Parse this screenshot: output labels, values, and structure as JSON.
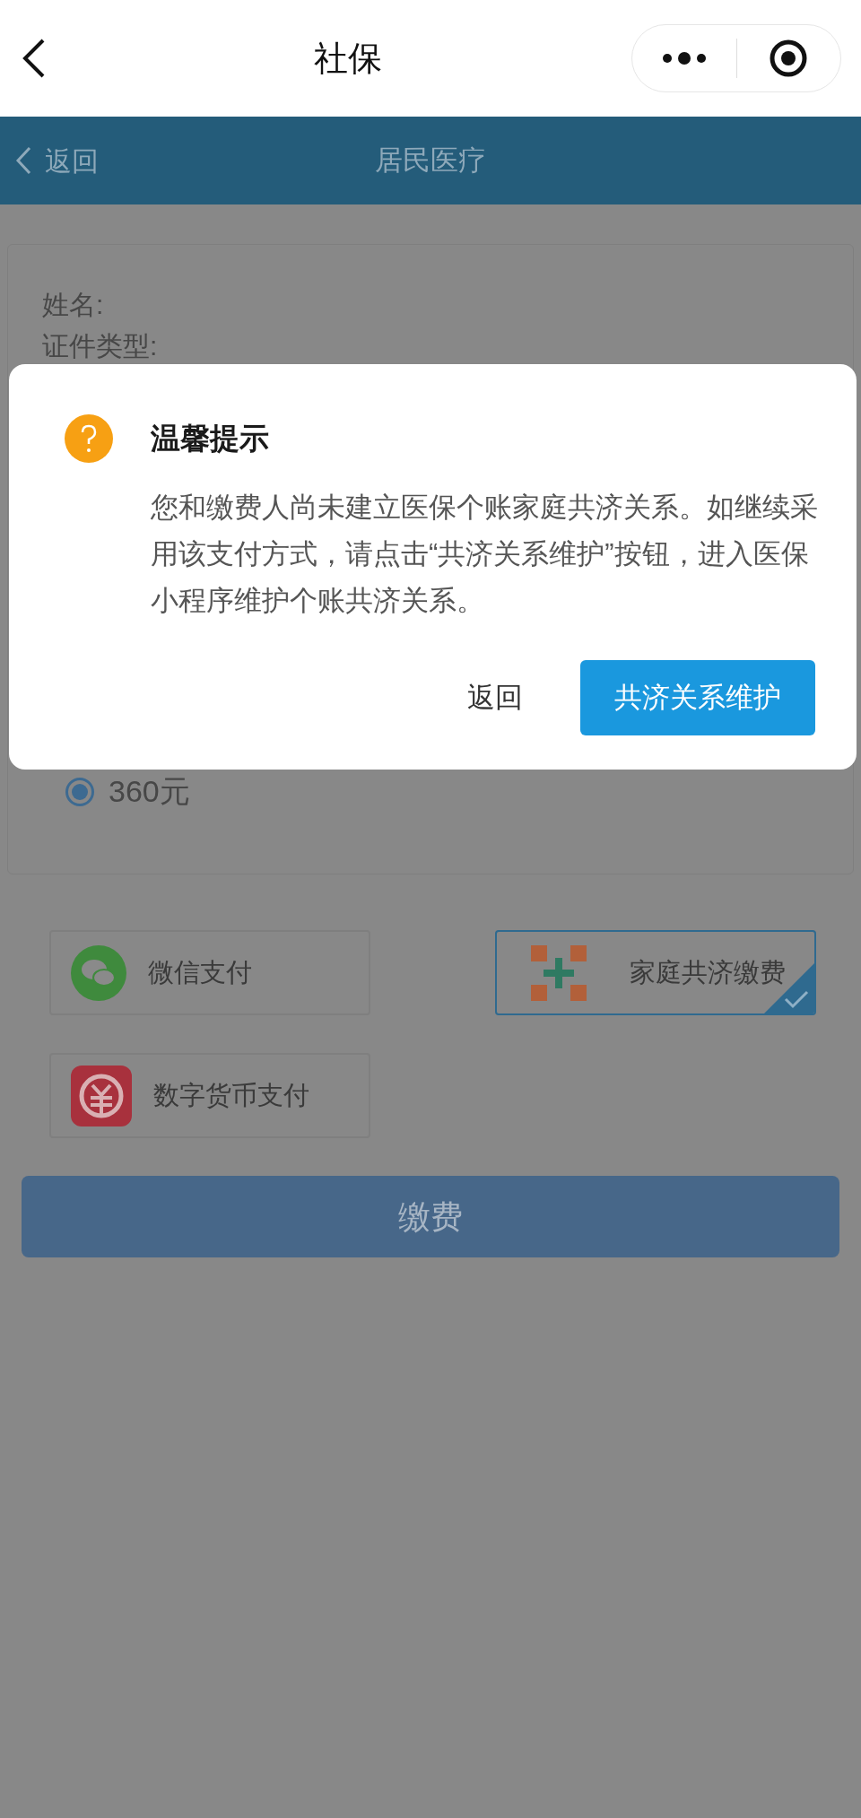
{
  "nav_bar": {
    "title": "社保"
  },
  "header": {
    "back": "返回",
    "title": "居民医疗"
  },
  "form": {
    "fields": [
      {
        "label": "姓名:"
      },
      {
        "label": "证件类型:"
      }
    ],
    "amount_options": [
      {
        "label": "360元",
        "selected": true
      }
    ]
  },
  "payment_methods": [
    {
      "kind": "wechat",
      "label": "微信支付",
      "selected": false
    },
    {
      "kind": "family",
      "label": "家庭共济缴费",
      "selected": true
    },
    {
      "kind": "digital",
      "label": "数字货币支付",
      "selected": false
    }
  ],
  "pay_button": "缴费",
  "dialog": {
    "title": "温馨提示",
    "message": "您和缴费人尚未建立医保个账家庭共济关系。如继续采用该支付方式，请点击“共济关系维护”按钮，进入医保小程序维护个账共济关系。",
    "buttons": [
      {
        "kind": "secondary",
        "label": "返回"
      },
      {
        "kind": "primary",
        "label": "共济关系维护"
      }
    ]
  }
}
